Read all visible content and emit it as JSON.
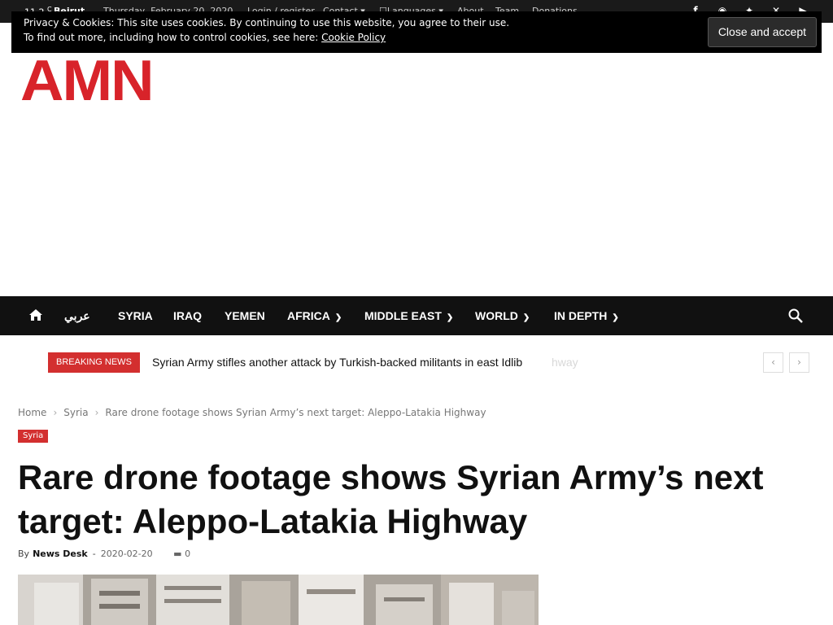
{
  "topbar": {
    "temperature": "11.2",
    "unit": "C",
    "city": "Beirut",
    "date": "Thursday, February 20, 2020",
    "links": [
      "Login / register",
      "Contact",
      "Languages",
      "About",
      "Team",
      "Donations"
    ]
  },
  "cookie": {
    "line1": "Privacy & Cookies: This site uses cookies. By continuing to use this website, you agree to their use.",
    "line2_prefix": "To find out more, including how to control cookies, see here: ",
    "policy_link": "Cookie Policy",
    "close_label": "Close and accept"
  },
  "logo": {
    "text": "AMN",
    "color": "#d8232a"
  },
  "nav": {
    "items": [
      "عربي",
      "SYRIA",
      "IRAQ",
      "YEMEN",
      "AFRICA",
      "MIDDLE EAST",
      "WORLD",
      "IN DEPTH"
    ]
  },
  "breaking": {
    "label": "BREAKING NEWS",
    "headline": "Syrian Army stifles another attack by Turkish-backed militants in east Idlib",
    "ghost": "hway"
  },
  "breadcrumb": {
    "home": "Home",
    "section": "Syria",
    "current": "Rare drone footage shows Syrian Army’s next target: Aleppo-Latakia Highway"
  },
  "article": {
    "category": "Syria",
    "title": "Rare drone footage shows Syrian Army’s next target: Aleppo-Latakia Highway",
    "by": "By",
    "author": "News Desk",
    "date": "2020-02-20",
    "comments": "0"
  },
  "colors": {
    "accent": "#d32f2f",
    "nav_bg": "#111111",
    "topbar_bg": "#1a1a1a"
  }
}
